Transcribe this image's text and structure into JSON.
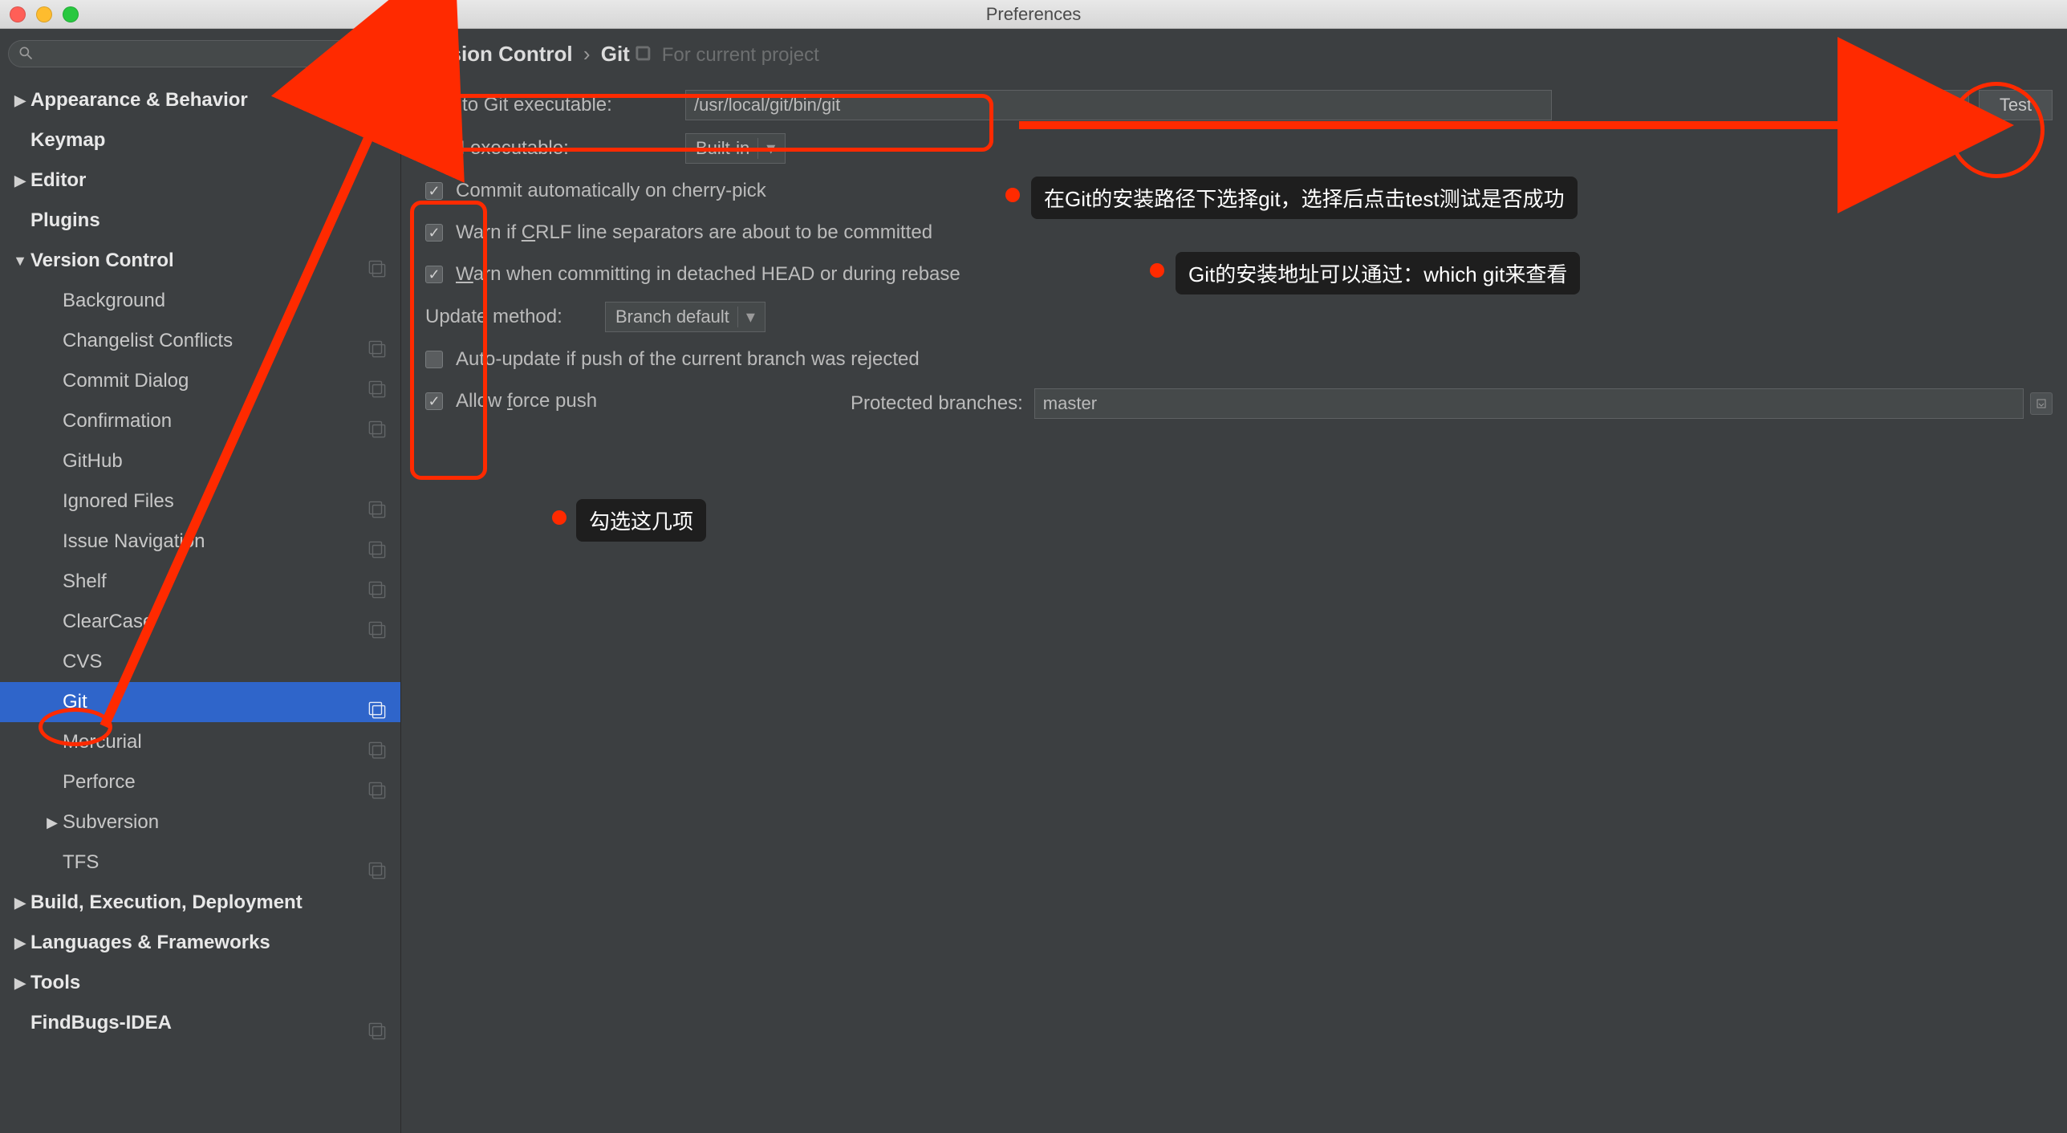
{
  "window": {
    "title": "Preferences"
  },
  "breadcrumb": {
    "root": "Version Control",
    "leaf": "Git",
    "scope": "For current project"
  },
  "sidebar": {
    "items": [
      {
        "label": "Appearance & Behavior",
        "bold": true,
        "arrow": "▶"
      },
      {
        "label": "Keymap",
        "bold": true
      },
      {
        "label": "Editor",
        "bold": true,
        "arrow": "▶"
      },
      {
        "label": "Plugins",
        "bold": true
      },
      {
        "label": "Version Control",
        "bold": true,
        "arrow": "▼",
        "badge": true
      },
      {
        "label": "Background",
        "sub": true
      },
      {
        "label": "Changelist Conflicts",
        "sub": true,
        "badge": true
      },
      {
        "label": "Commit Dialog",
        "sub": true,
        "badge": true
      },
      {
        "label": "Confirmation",
        "sub": true,
        "badge": true
      },
      {
        "label": "GitHub",
        "sub": true
      },
      {
        "label": "Ignored Files",
        "sub": true,
        "badge": true
      },
      {
        "label": "Issue Navigation",
        "sub": true,
        "badge": true
      },
      {
        "label": "Shelf",
        "sub": true,
        "badge": true
      },
      {
        "label": "ClearCase",
        "sub": true,
        "badge": true
      },
      {
        "label": "CVS",
        "sub": true
      },
      {
        "label": "Git",
        "sub": true,
        "badge": true,
        "selected": true
      },
      {
        "label": "Mercurial",
        "sub": true,
        "badge": true
      },
      {
        "label": "Perforce",
        "sub": true,
        "badge": true
      },
      {
        "label": "Subversion",
        "sub": true,
        "arrow": "▶"
      },
      {
        "label": "TFS",
        "sub": true,
        "badge": true
      },
      {
        "label": "Build, Execution, Deployment",
        "bold": true,
        "arrow": "▶"
      },
      {
        "label": "Languages & Frameworks",
        "bold": true,
        "arrow": "▶"
      },
      {
        "label": "Tools",
        "bold": true,
        "arrow": "▶"
      },
      {
        "label": "FindBugs-IDEA",
        "bold": true,
        "badge": true
      }
    ]
  },
  "form": {
    "path_label": "Path to Git executable:",
    "path_value": "/usr/local/git/bin/git",
    "ellipsis": "...",
    "test": "Test",
    "ssh_label": "SSH executable:",
    "ssh_value": "Built-in",
    "checks": [
      {
        "label": "Commit automatically on cherry-pick",
        "checked": true
      },
      {
        "label": "Warn if CRLF line separators are about to be committed",
        "checked": true,
        "u": "C"
      },
      {
        "label": "Warn when committing in detached HEAD or during rebase",
        "checked": true,
        "u": "W"
      }
    ],
    "update_label": "Update method:",
    "update_value": "Branch default",
    "checks2": [
      {
        "label": "Auto-update if push of the current branch was rejected",
        "checked": false
      },
      {
        "label": "Allow force push",
        "checked": true,
        "u": "f"
      }
    ],
    "protected_label": "Protected branches:",
    "protected_value": "master"
  },
  "annotations": {
    "t1": "在Git的安装路径下选择git，选择后点击test测试是否成功",
    "t2": "Git的安装地址可以通过：which git来查看",
    "t3": "勾选这几项"
  }
}
